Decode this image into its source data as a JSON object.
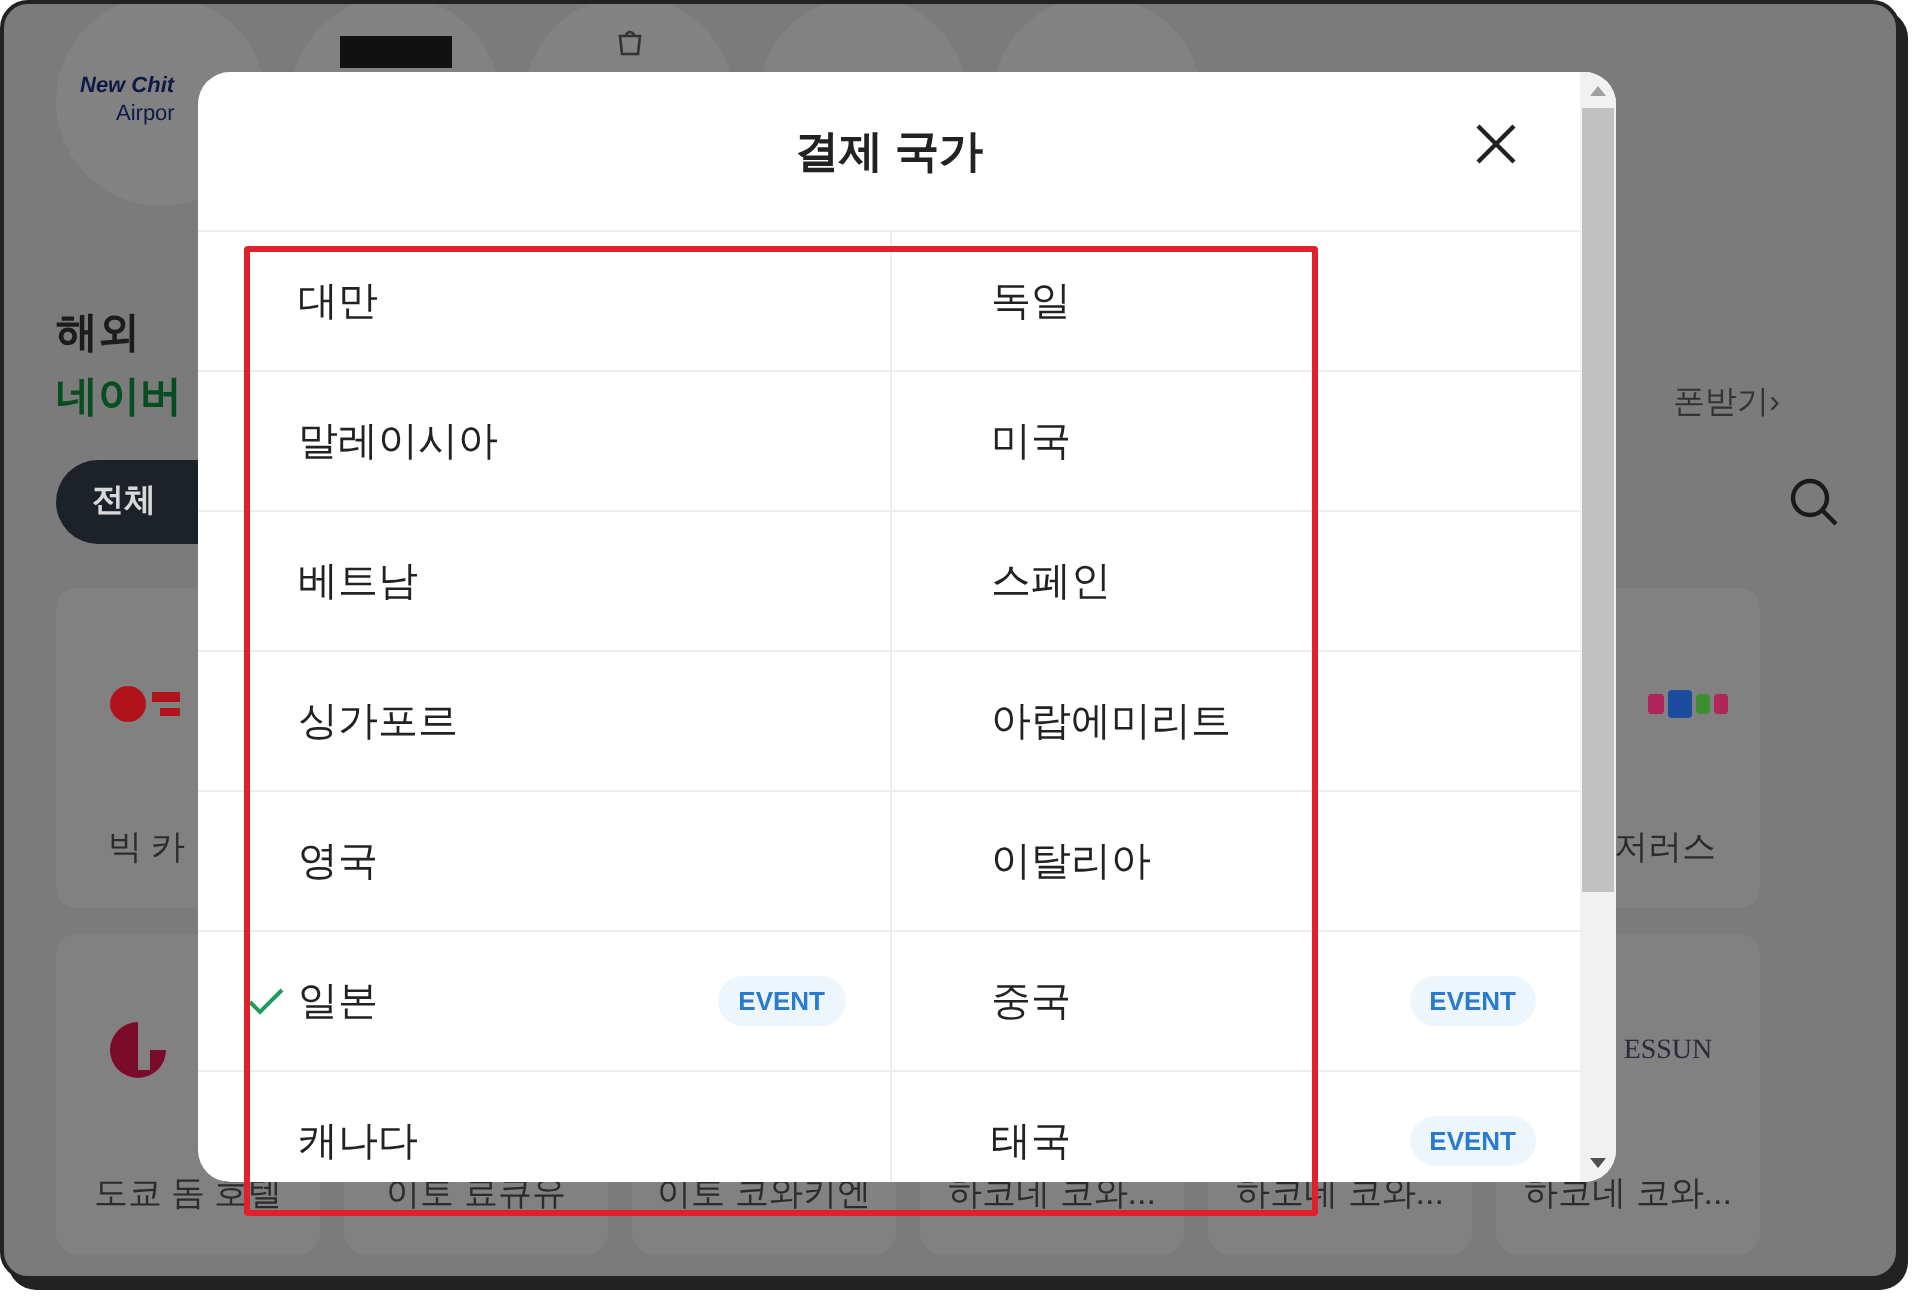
{
  "background": {
    "logo_circles": [
      {
        "kind": "text",
        "line1": "New Chit",
        "line2": "Airpor"
      },
      {
        "kind": "dark"
      },
      {
        "kind": "icon"
      },
      {
        "kind": "plain"
      },
      {
        "kind": "plain"
      }
    ],
    "heading": "해외",
    "subheading": "네이버",
    "coupon_link": "폰받기›",
    "filter_chip": {
      "label": "전체",
      "selected": true
    },
    "top_cards": [
      {
        "kind": "bic",
        "label": "빅 카"
      },
      {
        "kind": "toys",
        "label": "저러스"
      }
    ],
    "bottom_cards": [
      {
        "kind": "dome",
        "label": "도쿄 돔 호텔"
      },
      {
        "label": "이토 료큐유"
      },
      {
        "label": "이토 코와키엔"
      },
      {
        "label": "하코네 코와..."
      },
      {
        "label": "하코네 코와..."
      },
      {
        "kind": "wordmark",
        "logo_text": "ESSUN",
        "label": "하코네 코와..."
      }
    ]
  },
  "dialog": {
    "title": "결제 국가",
    "countries": [
      {
        "name": "대만",
        "selected": false,
        "event": false
      },
      {
        "name": "독일",
        "selected": false,
        "event": false
      },
      {
        "name": "말레이시아",
        "selected": false,
        "event": false
      },
      {
        "name": "미국",
        "selected": false,
        "event": false
      },
      {
        "name": "베트남",
        "selected": false,
        "event": false
      },
      {
        "name": "스페인",
        "selected": false,
        "event": false
      },
      {
        "name": "싱가포르",
        "selected": false,
        "event": false
      },
      {
        "name": "아랍에미리트",
        "selected": false,
        "event": false
      },
      {
        "name": "영국",
        "selected": false,
        "event": false
      },
      {
        "name": "이탈리아",
        "selected": false,
        "event": false
      },
      {
        "name": "일본",
        "selected": true,
        "event": true,
        "badge": "EVENT"
      },
      {
        "name": "중국",
        "selected": false,
        "event": true,
        "badge": "EVENT"
      },
      {
        "name": "캐나다",
        "selected": false,
        "event": false
      },
      {
        "name": "태국",
        "selected": false,
        "event": true,
        "badge": "EVENT"
      }
    ]
  }
}
